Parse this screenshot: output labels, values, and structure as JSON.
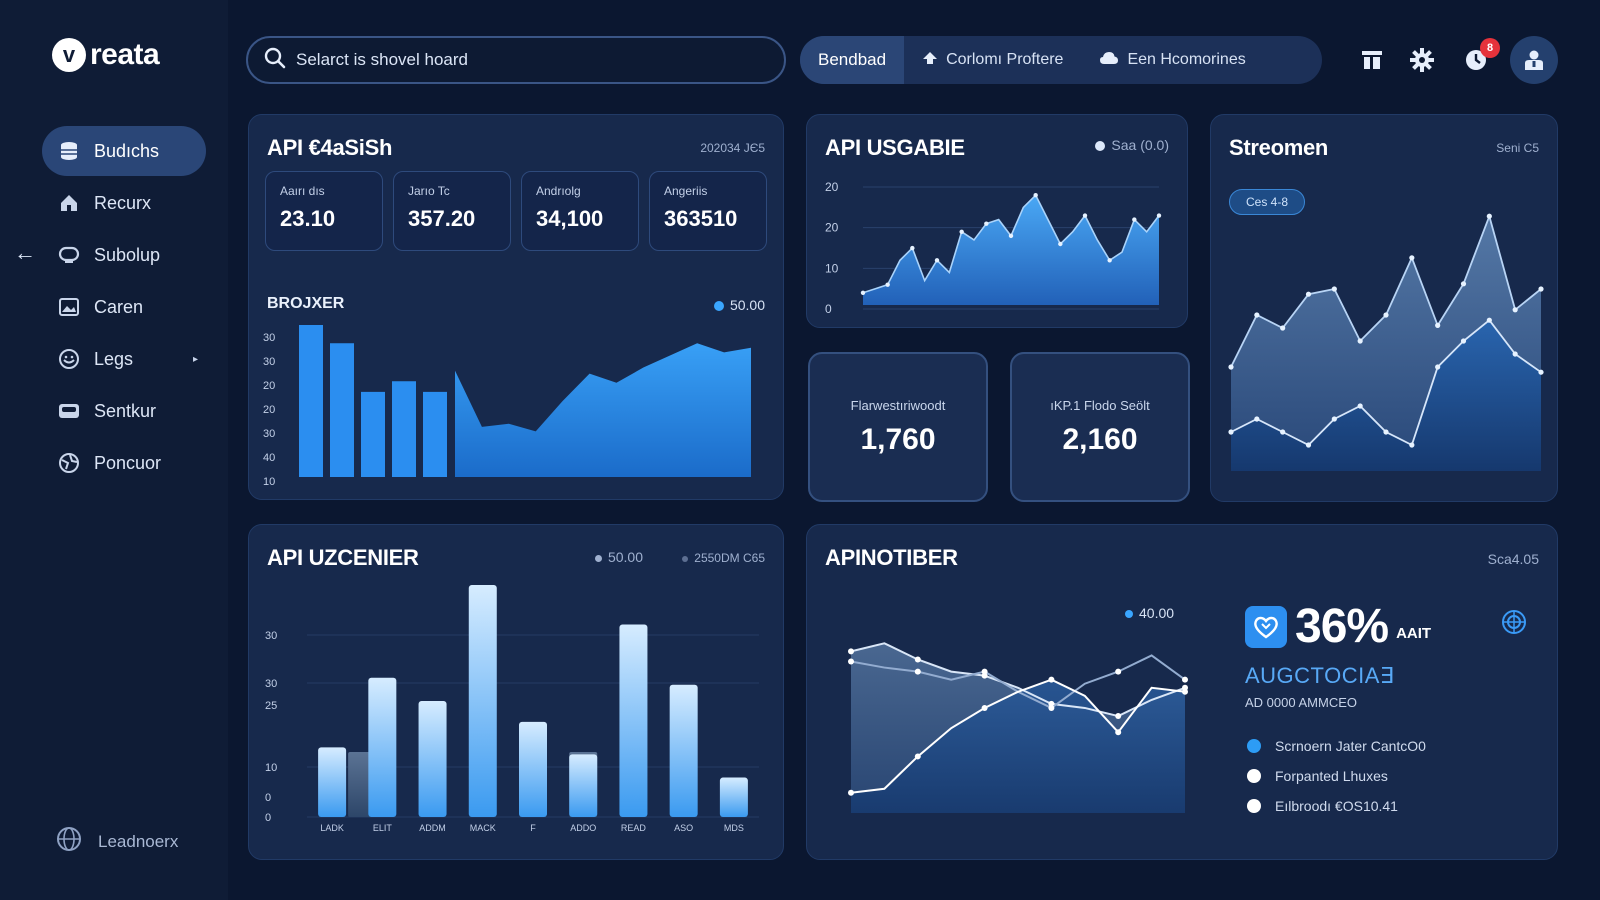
{
  "app": {
    "logo_letter": "v",
    "logo_text": "reata"
  },
  "sidebar": {
    "items": [
      {
        "label": "Budıchs",
        "icon": "database-icon",
        "active": true
      },
      {
        "label": "Recurx",
        "icon": "home-icon"
      },
      {
        "label": "Subolup",
        "icon": "shield-icon"
      },
      {
        "label": "Caren",
        "icon": "image-icon"
      },
      {
        "label": "Legs",
        "icon": "face-icon",
        "has_submenu": true
      },
      {
        "label": "Sentkur",
        "icon": "box-icon"
      },
      {
        "label": "Poncuor",
        "icon": "globe-icon"
      }
    ],
    "footer_label": "Leadnoerx"
  },
  "search": {
    "value": "Selarct is shovel hoard"
  },
  "tabs": [
    {
      "label": "Bendbad",
      "active": true
    },
    {
      "label": "Corlomı Proftere",
      "icon": "upload-icon"
    },
    {
      "label": "Een Hcomorines",
      "icon": "cloud-icon"
    }
  ],
  "notifications": {
    "count": "8"
  },
  "colors": {
    "accent": "#2d8ff0",
    "background": "#0b1730",
    "card": "#17294c",
    "danger": "#e5323b"
  },
  "cards": {
    "api_analysis": {
      "title": "API €4aSiSh",
      "meta": "202034 ЈЄ5",
      "mini_stats": [
        {
          "label": "Aaırı dıs",
          "value": "23.10"
        },
        {
          "label": "Jarıo Tc",
          "value": "357.20"
        },
        {
          "label": "Andrıolg",
          "value": "34,100"
        },
        {
          "label": "Angeriis",
          "value": "363510"
        }
      ],
      "sub_title": "BROJXER",
      "sub_meta": "50.00"
    },
    "api_usage": {
      "title": "API USGABIE",
      "meta": "Saa (0.0)"
    },
    "stat_1": {
      "label": "Flarwestıriwoodt",
      "value": "1,760"
    },
    "stat_2": {
      "label": "ıKP.1 Flodo Seölt",
      "value": "2,160"
    },
    "streams": {
      "title": "Streomen",
      "meta": "Seni C5",
      "pill": "Ces 4-8"
    },
    "api_uzcenier": {
      "title": "API UZCENIER",
      "meta_1": "50.00",
      "meta_2": "2550DM C65"
    },
    "api_notiber": {
      "title": "APINOTIBER",
      "meta": "Sca4.05",
      "chart_marker": "40.00",
      "kpi_value": "36%",
      "kpi_suffix": "AAIT",
      "kpi_title": "AUGCTOCIA∃",
      "kpi_sub": "AD 0000 AMMCEO",
      "legend": [
        {
          "label": "Scrnoern Jater CantcO0",
          "color": "#2d9cf5"
        },
        {
          "label": "Forpanted Lhuxes",
          "color": "#ffffff"
        },
        {
          "label": "Eılbroodı €OS10.41",
          "color": "#ffffff"
        }
      ]
    }
  },
  "chart_data": [
    {
      "type": "bar",
      "name": "BROJXER",
      "yticks": [
        "30",
        "30",
        "20",
        "20",
        "30",
        "40",
        "10"
      ],
      "values": [
        100,
        88,
        56,
        63,
        56
      ],
      "area": {
        "x": [
          0,
          1,
          2,
          3,
          4,
          5,
          6,
          7,
          8,
          9,
          10,
          11
        ],
        "values": [
          70,
          33,
          35,
          30,
          50,
          68,
          62,
          72,
          80,
          88,
          82,
          85
        ]
      }
    },
    {
      "type": "area",
      "name": "API USGABIE",
      "yticks": [
        "20",
        "20",
        "10",
        "0"
      ],
      "values": [
        3,
        4,
        5,
        11,
        14,
        6,
        11,
        8,
        18,
        16,
        20,
        21,
        17,
        24,
        27,
        21,
        15,
        18,
        22,
        16,
        11,
        13,
        21,
        18,
        22
      ]
    },
    {
      "type": "area",
      "name": "Streomen",
      "series": [
        {
          "values": [
            40,
            60,
            55,
            68,
            70,
            50,
            60,
            82,
            56,
            72,
            98,
            62,
            70
          ]
        },
        {
          "values": [
            15,
            20,
            15,
            10,
            20,
            25,
            15,
            10,
            40,
            50,
            58,
            45,
            38
          ]
        }
      ]
    },
    {
      "type": "bar",
      "name": "API UZCENIER",
      "categories": [
        "LADK",
        "ELIT",
        "ADDM",
        "MACK",
        "F",
        "ADDO",
        "READ",
        "ASO",
        "MDS"
      ],
      "yticks": [
        "30",
        "30",
        "25",
        "",
        "10",
        "0",
        "0"
      ],
      "values": [
        30,
        60,
        50,
        100,
        41,
        27,
        83,
        57,
        17
      ],
      "ghost_values": [
        28,
        0,
        0,
        0,
        0,
        28,
        0,
        0,
        0
      ]
    },
    {
      "type": "line",
      "name": "APINOTIBER",
      "series": [
        {
          "values": [
            80,
            84,
            76,
            70,
            68,
            62,
            54,
            52,
            48,
            56,
            62
          ]
        },
        {
          "values": [
            75,
            72,
            70,
            66,
            70,
            60,
            52,
            64,
            70,
            78,
            66
          ]
        },
        {
          "values": [
            10,
            12,
            28,
            42,
            52,
            60,
            66,
            58,
            40,
            62,
            60
          ]
        }
      ]
    }
  ]
}
